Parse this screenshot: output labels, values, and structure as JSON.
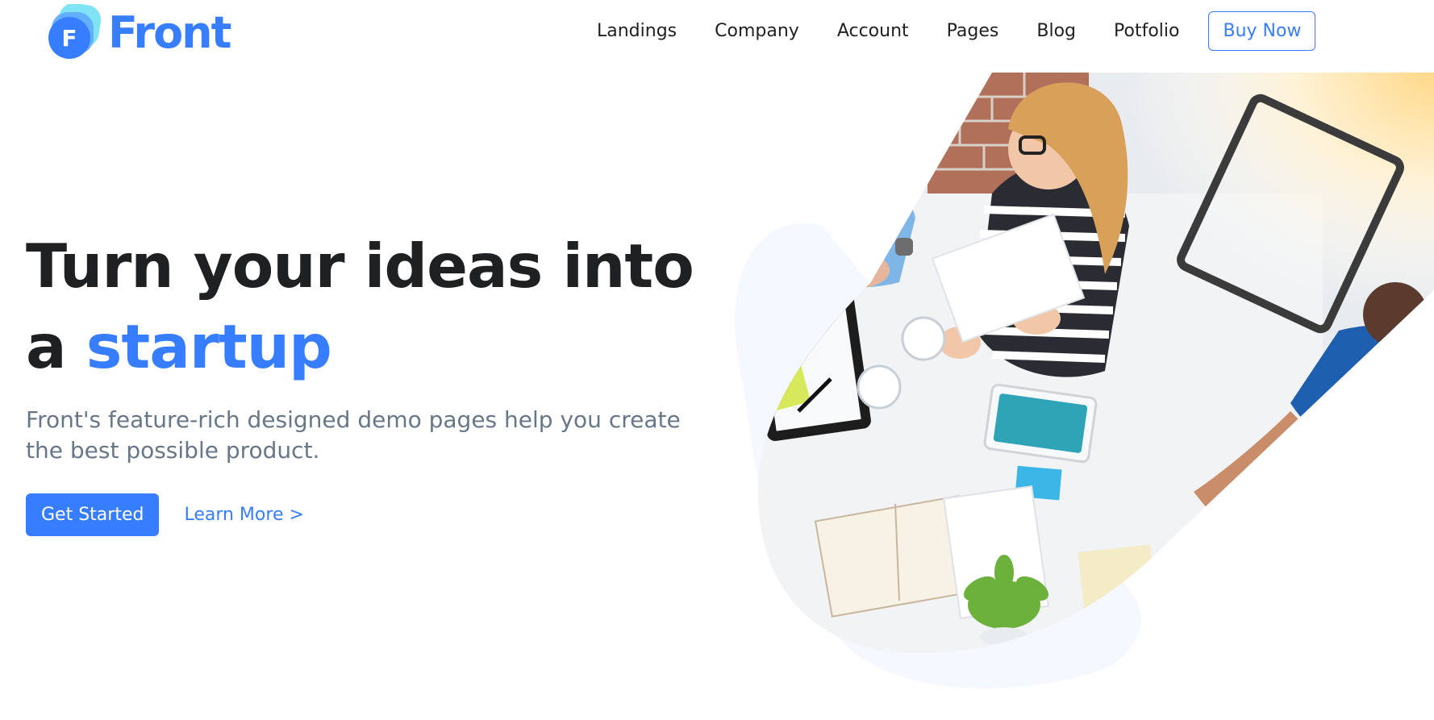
{
  "brand": {
    "name": "Front",
    "mark_letter": "F",
    "color_primary": "#377dff"
  },
  "nav": {
    "items": [
      {
        "label": "Landings"
      },
      {
        "label": "Company"
      },
      {
        "label": "Account"
      },
      {
        "label": "Pages"
      },
      {
        "label": "Blog"
      },
      {
        "label": "Potfolio"
      }
    ],
    "buy_label": "Buy Now"
  },
  "hero": {
    "title_line1": "Turn your ideas into",
    "title_prefix": "a",
    "title_accent": "startup",
    "description": "Front's feature-rich designed demo pages help you create the best possible product.",
    "primary_cta": "Get Started",
    "secondary_cta": "Learn More >",
    "image_icon": "team-meeting-photo-icon"
  }
}
